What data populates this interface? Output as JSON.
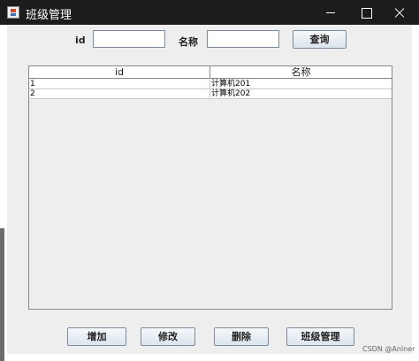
{
  "window": {
    "title": "班级管理",
    "controls": [
      "minimize-icon",
      "maximize-icon",
      "close-icon"
    ]
  },
  "search": {
    "id_label": "id",
    "id_value": "",
    "name_label": "名称",
    "name_value": "",
    "query_button": "查询"
  },
  "table": {
    "columns": [
      "id",
      "名称"
    ],
    "rows": [
      [
        "1",
        "计算机201"
      ],
      [
        "2",
        "计算机202"
      ]
    ]
  },
  "actions": {
    "add": "增加",
    "edit": "修改",
    "delete": "删除",
    "class_manage": "班级管理"
  },
  "watermark": "CSDN @Anlner"
}
